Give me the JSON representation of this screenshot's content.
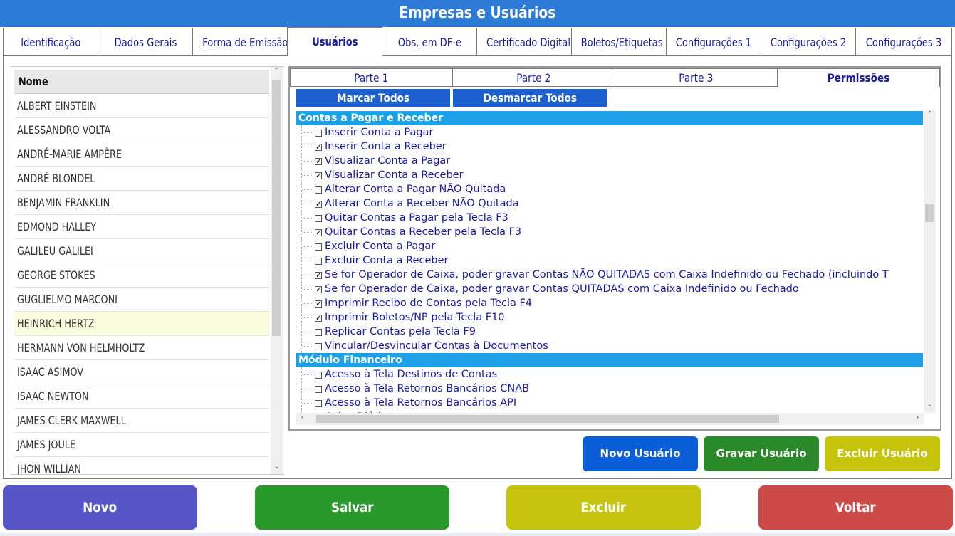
{
  "window": {
    "title": "Empresas e Usuários"
  },
  "main_tabs": [
    {
      "label": "Identificação",
      "active": false
    },
    {
      "label": "Dados Gerais",
      "active": false
    },
    {
      "label": "Forma de Emissão",
      "active": false
    },
    {
      "label": "Usuários",
      "active": true
    },
    {
      "label": "Obs. em DF-e",
      "active": false
    },
    {
      "label": "Certificado Digital",
      "active": false
    },
    {
      "label": "Boletos/Etiquetas",
      "active": false
    },
    {
      "label": "Configurações 1",
      "active": false
    },
    {
      "label": "Configurações 2",
      "active": false
    },
    {
      "label": "Configurações 3",
      "active": false
    }
  ],
  "user_list": {
    "header": "Nome",
    "selected": "HEINRICH HERTZ",
    "users": [
      "ALBERT EINSTEIN",
      "ALESSANDRO VOLTA",
      "ANDRÉ-MARIE AMPÈRE",
      "ANDRÉ BLONDEL",
      "BENJAMIN FRANKLIN",
      "EDMOND HALLEY",
      "GALILEU GALILEI",
      "GEORGE STOKES",
      "GUGLIELMO MARCONI",
      "HEINRICH HERTZ",
      "HERMANN VON HELMHOLTZ",
      "ISAAC ASIMOV",
      "ISAAC NEWTON",
      "JAMES CLERK MAXWELL",
      "JAMES JOULE",
      "JHON WILLIAN"
    ]
  },
  "sub_tabs": [
    {
      "label": "Parte 1",
      "active": false
    },
    {
      "label": "Parte 2",
      "active": false
    },
    {
      "label": "Parte 3",
      "active": false
    },
    {
      "label": "Permissões",
      "active": true
    }
  ],
  "perm_buttons": {
    "mark_all": "Marcar Todos",
    "unmark_all": "Desmarcar Todos"
  },
  "permissions": [
    {
      "type": "section",
      "label": "Contas a Pagar e Receber"
    },
    {
      "type": "item",
      "label": "Inserir Conta a Pagar",
      "checked": false
    },
    {
      "type": "item",
      "label": "Inserir Conta a Receber",
      "checked": true
    },
    {
      "type": "item",
      "label": "Visualizar Conta a Pagar",
      "checked": true
    },
    {
      "type": "item",
      "label": "Visualizar Conta a Receber",
      "checked": true
    },
    {
      "type": "item",
      "label": "Alterar Conta a Pagar NÃO Quitada",
      "checked": false
    },
    {
      "type": "item",
      "label": "Alterar Conta a Receber NÃO Quitada",
      "checked": true
    },
    {
      "type": "item",
      "label": "Quitar Contas a Pagar pela Tecla F3",
      "checked": false
    },
    {
      "type": "item",
      "label": "Quitar Contas a Receber pela Tecla F3",
      "checked": true
    },
    {
      "type": "item",
      "label": "Excluir Conta a Pagar",
      "checked": false
    },
    {
      "type": "item",
      "label": "Excluir Conta a Receber",
      "checked": false
    },
    {
      "type": "item",
      "label": "Se for Operador de Caixa, poder gravar Contas NÃO QUITADAS com Caixa Indefinido ou Fechado (incluindo T",
      "checked": true
    },
    {
      "type": "item",
      "label": "Se for Operador de Caixa, poder gravar Contas QUITADAS com Caixa Indefinido ou Fechado",
      "checked": true
    },
    {
      "type": "item",
      "label": "Imprimir Recibo de Contas pela Tecla F4",
      "checked": true
    },
    {
      "type": "item",
      "label": "Imprimir Boletos/NP pela Tecla F10",
      "checked": true
    },
    {
      "type": "item",
      "label": "Replicar Contas pela Tecla F9",
      "checked": false
    },
    {
      "type": "item",
      "label": "Vincular/Desvincular Contas à Documentos",
      "checked": false
    },
    {
      "type": "section",
      "label": "Módulo Financeiro"
    },
    {
      "type": "item",
      "label": "Acesso à Tela Destinos de Contas",
      "checked": false
    },
    {
      "type": "item",
      "label": "Acesso à Tela Retornos Bancários CNAB",
      "checked": false
    },
    {
      "type": "item",
      "label": "Acesso à Tela Retornos Bancários API",
      "checked": false
    },
    {
      "type": "item",
      "label": "Caixa Diário",
      "checked": false
    }
  ],
  "user_buttons": {
    "new": "Novo Usuário",
    "save": "Gravar Usuário",
    "delete": "Excluir Usuário"
  },
  "bottom_buttons": {
    "new": "Novo",
    "save": "Salvar",
    "delete": "Excluir",
    "back": "Voltar"
  },
  "colors": {
    "title_bar": "#2d7bd6",
    "tab_text": "#1a1aa0",
    "section_header": "#1ea0e6",
    "blue_button": "#1e5fd0",
    "novo_usuario": "#0a5fd8",
    "gravar_usuario": "#2a8a2a",
    "excluir_usuario": "#c5c40a",
    "novo": "#5656c8",
    "salvar": "#2a982a",
    "excluir": "#c6c40e",
    "voltar": "#cc4a48"
  }
}
